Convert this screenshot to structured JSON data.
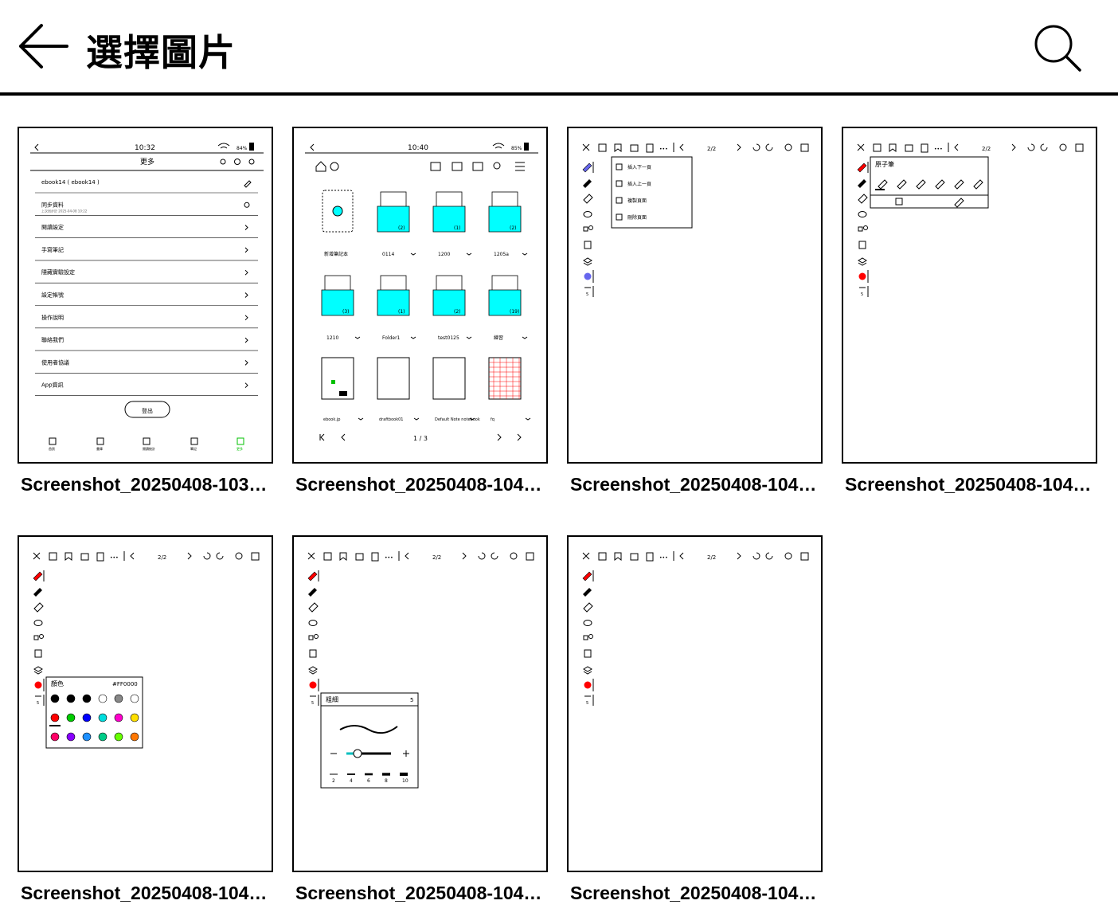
{
  "header": {
    "title": "選擇圖片",
    "back_icon": "arrow-left-icon",
    "search_icon": "search-icon"
  },
  "items": [
    {
      "caption": "Screenshot_20250408-103…"
    },
    {
      "caption": "Screenshot_20250408-104…"
    },
    {
      "caption": "Screenshot_20250408-104…"
    },
    {
      "caption": "Screenshot_20250408-104…"
    },
    {
      "caption": "Screenshot_20250408-104…"
    },
    {
      "caption": "Screenshot_20250408-104…"
    },
    {
      "caption": "Screenshot_20250408-104…"
    }
  ],
  "thumb1": {
    "time": "10:32",
    "battery": "84%",
    "title": "更多",
    "rows": [
      "ebook14 ( ebook14 )",
      "同步資料",
      "閱讀設定",
      "手寫筆記",
      "隱藏實驗設定",
      "設定帳號",
      "操作說明",
      "聯絡我們",
      "使用者協議",
      "App資訊"
    ],
    "sync_time": "上次同步於 2025-04-08 10:22",
    "logout": "登出",
    "nav": [
      "首頁",
      "書庫",
      "閱讀統計",
      "筆記",
      "更多"
    ]
  },
  "thumb2": {
    "time": "10:40",
    "battery": "85%",
    "new_label": "新增筆記本",
    "folders": [
      {
        "name": "0114",
        "count": "(2)"
      },
      {
        "name": "1200",
        "count": "(1)"
      },
      {
        "name": "1205a",
        "count": "(2)"
      },
      {
        "name": "1210",
        "count": "(3)"
      },
      {
        "name": "Folder1",
        "count": "(1)"
      },
      {
        "name": "test0125",
        "count": "(2)"
      },
      {
        "name": "練習",
        "count": "(19)"
      }
    ],
    "notebooks": [
      "ebook.jp",
      "draftbook01",
      "Default Note notebook",
      "fq"
    ],
    "page": "1 / 3"
  },
  "thumb3": {
    "page": "2/2",
    "menu": [
      "插入下一頁",
      "插入上一頁",
      "複製頁面",
      "刪除頁面"
    ]
  },
  "thumb4": {
    "page": "2/2",
    "panel_title": "原子筆"
  },
  "thumb5": {
    "page": "2/2",
    "panel_title": "顏色",
    "hex": "#FF0000"
  },
  "thumb6": {
    "page": "2/2",
    "panel_title": "粗細",
    "value": "5",
    "sizes": [
      "2",
      "4",
      "6",
      "8",
      "10"
    ]
  },
  "thumb7": {
    "page": "2/2"
  },
  "colors": {
    "cyan": "#00FFFF",
    "red": "#FF0000",
    "blue_dot": "#6666EE"
  }
}
